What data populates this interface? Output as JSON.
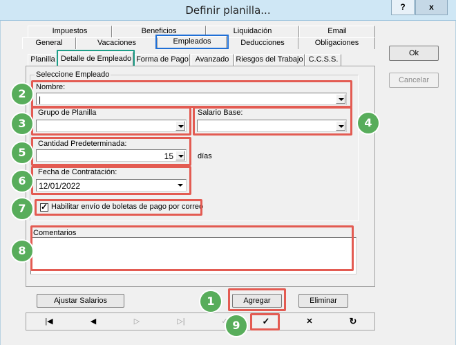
{
  "window": {
    "title": "Definir planilla...",
    "help_label": "?",
    "close_label": "x"
  },
  "tabs_row1": [
    "Impuestos",
    "Beneficios",
    "Liquidación",
    "Email"
  ],
  "tabs_row2": [
    "General",
    "Vacaciones",
    "Empleados",
    "Deducciones",
    "Obligaciones"
  ],
  "tabs_row3": [
    "Planilla",
    "Detalle de Empleado",
    "Forma de Pago",
    "Avanzado",
    "Riesgos del Trabajo",
    "C.C.S.S."
  ],
  "group": {
    "legend": "Seleccione Empleado"
  },
  "form": {
    "nombre_label": "Nombre:",
    "nombre_value": "|",
    "grupo_label": "Grupo de Planilla",
    "grupo_value": "",
    "salario_label": "Salario Base:",
    "salario_value": "",
    "cantidad_label": "Cantidad Predeterminada:",
    "cantidad_value": "15",
    "cantidad_unit": "días",
    "fecha_label": "Fecha de Contratación:",
    "fecha_value": "12/01/2022",
    "checkbox_label": "Habilitar envío de boletas de pago por correo",
    "checkbox_checked": true,
    "comentarios_label": "Comentarios"
  },
  "buttons": {
    "ok": "Ok",
    "cancelar": "Cancelar",
    "ajustar": "Ajustar Salarios",
    "agregar": "Agregar",
    "eliminar": "Eliminar"
  },
  "nav": {
    "first": "|◀",
    "prev": "◀",
    "next": "▷",
    "last": "▷|",
    "edit": "✓",
    "confirm": "✓",
    "cancel": "✕",
    "refresh": "↻"
  },
  "callouts": [
    "1",
    "2",
    "3",
    "4",
    "5",
    "6",
    "7",
    "8",
    "9"
  ],
  "colors": {
    "highlight_red": "#e35b52",
    "highlight_blue": "#1f6fd6",
    "highlight_teal": "#1d9e88",
    "callout_green": "#58ad5b"
  }
}
